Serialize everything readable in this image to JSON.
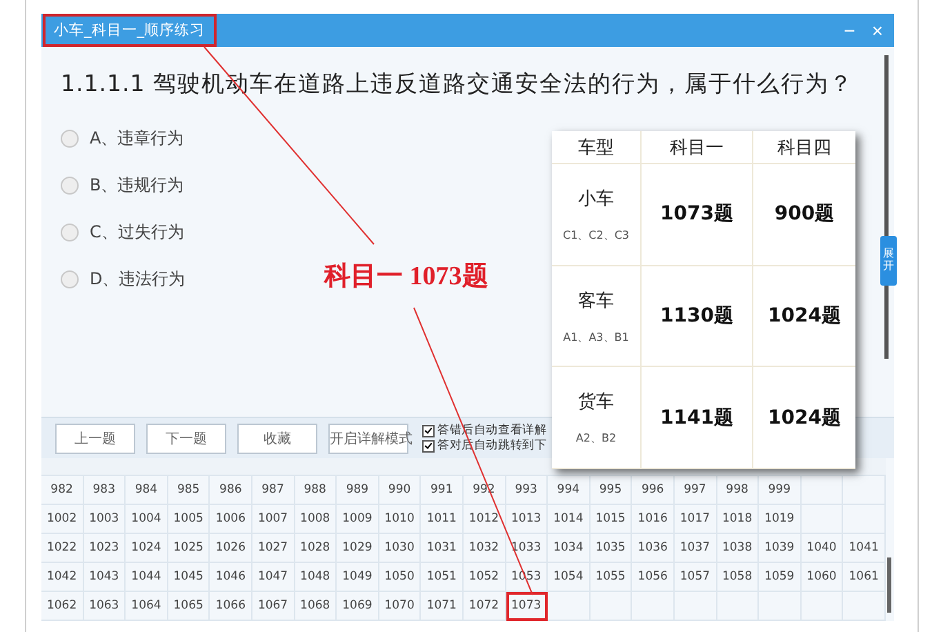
{
  "window": {
    "title": "小车_科目一_顺序练习",
    "controls": [
      "−",
      "×"
    ]
  },
  "question": {
    "text": "1.1.1.1 驾驶机动车在道路上违反道路交通安全法的行为，属于什么行为？",
    "options": [
      {
        "label": "A、违章行为",
        "selected": false
      },
      {
        "label": "B、违规行为",
        "selected": false
      },
      {
        "label": "C、过失行为",
        "selected": false
      },
      {
        "label": "D、违法行为",
        "selected": false
      }
    ]
  },
  "side_tab": "展开",
  "toolbar": {
    "buttons": [
      "上一题",
      "下一题",
      "收藏",
      "开启详解模式"
    ],
    "checkboxes": [
      {
        "label": "答错后自动查看详解",
        "checked": true
      },
      {
        "label": "答对后自动跳转到下",
        "checked": true
      }
    ]
  },
  "grid": {
    "rows": [
      [
        {
          "n": "982",
          "marked": false
        },
        {
          "n": "983",
          "marked": false
        },
        {
          "n": "984",
          "marked": false
        },
        {
          "n": "985",
          "marked": false
        },
        {
          "n": "986",
          "marked": false
        },
        {
          "n": "987",
          "marked": false
        },
        {
          "n": "988",
          "marked": false
        },
        {
          "n": "989",
          "marked": false
        },
        {
          "n": "990",
          "marked": false
        },
        {
          "n": "991",
          "marked": false
        },
        {
          "n": "992",
          "marked": false
        },
        {
          "n": "993",
          "marked": false
        },
        {
          "n": "994",
          "marked": false
        },
        {
          "n": "995",
          "marked": false
        },
        {
          "n": "996",
          "marked": false
        },
        {
          "n": "997",
          "marked": false
        },
        {
          "n": "998",
          "marked": false
        },
        {
          "n": "999",
          "marked": false
        },
        null,
        null
      ],
      [
        {
          "n": "1002",
          "marked": false
        },
        {
          "n": "1003",
          "marked": false
        },
        {
          "n": "1004",
          "marked": false
        },
        {
          "n": "1005",
          "marked": false
        },
        {
          "n": "1006",
          "marked": false
        },
        {
          "n": "1007",
          "marked": false
        },
        {
          "n": "1008",
          "marked": false
        },
        {
          "n": "1009",
          "marked": false
        },
        {
          "n": "1010",
          "marked": false
        },
        {
          "n": "1011",
          "marked": false
        },
        {
          "n": "1012",
          "marked": false
        },
        {
          "n": "1013",
          "marked": false
        },
        {
          "n": "1014",
          "marked": false
        },
        {
          "n": "1015",
          "marked": false
        },
        {
          "n": "1016",
          "marked": false
        },
        {
          "n": "1017",
          "marked": false
        },
        {
          "n": "1018",
          "marked": false
        },
        {
          "n": "1019",
          "marked": false
        },
        null,
        null
      ],
      [
        {
          "n": "1022",
          "marked": false
        },
        {
          "n": "1023",
          "marked": false
        },
        {
          "n": "1024",
          "marked": false
        },
        {
          "n": "1025",
          "marked": false
        },
        {
          "n": "1026",
          "marked": false
        },
        {
          "n": "1027",
          "marked": false
        },
        {
          "n": "1028",
          "marked": false
        },
        {
          "n": "1029",
          "marked": false
        },
        {
          "n": "1030",
          "marked": false
        },
        {
          "n": "1031",
          "marked": false
        },
        {
          "n": "1032",
          "marked": false
        },
        {
          "n": "1033",
          "marked": false
        },
        {
          "n": "1034",
          "marked": false
        },
        {
          "n": "1035",
          "marked": false
        },
        {
          "n": "1036",
          "marked": false
        },
        {
          "n": "1037",
          "marked": false
        },
        {
          "n": "1038",
          "marked": false
        },
        {
          "n": "1039",
          "marked": false
        },
        {
          "n": "1040",
          "marked": false
        },
        {
          "n": "1041",
          "marked": false
        }
      ],
      [
        {
          "n": "1042",
          "marked": false
        },
        {
          "n": "1043",
          "marked": false
        },
        {
          "n": "1044",
          "marked": false
        },
        {
          "n": "1045",
          "marked": false
        },
        {
          "n": "1046",
          "marked": false
        },
        {
          "n": "1047",
          "marked": false
        },
        {
          "n": "1048",
          "marked": false
        },
        {
          "n": "1049",
          "marked": false
        },
        {
          "n": "1050",
          "marked": false
        },
        {
          "n": "1051",
          "marked": false
        },
        {
          "n": "1052",
          "marked": false
        },
        {
          "n": "1053",
          "marked": false
        },
        {
          "n": "1054",
          "marked": false
        },
        {
          "n": "1055",
          "marked": false
        },
        {
          "n": "1056",
          "marked": false
        },
        {
          "n": "1057",
          "marked": false
        },
        {
          "n": "1058",
          "marked": false
        },
        {
          "n": "1059",
          "marked": false
        },
        {
          "n": "1060",
          "marked": false
        },
        {
          "n": "1061",
          "marked": false
        }
      ],
      [
        {
          "n": "1062",
          "marked": false
        },
        {
          "n": "1063",
          "marked": false
        },
        {
          "n": "1064",
          "marked": false
        },
        {
          "n": "1065",
          "marked": false
        },
        {
          "n": "1066",
          "marked": false
        },
        {
          "n": "1067",
          "marked": false
        },
        {
          "n": "1068",
          "marked": false
        },
        {
          "n": "1069",
          "marked": false
        },
        {
          "n": "1070",
          "marked": false
        },
        {
          "n": "1071",
          "marked": false
        },
        {
          "n": "1072",
          "marked": false
        },
        {
          "n": "1073",
          "marked": true
        },
        null,
        null,
        null,
        null,
        null,
        null,
        null,
        null
      ]
    ]
  },
  "overlay_table": {
    "columns": [
      "车型",
      "科目一",
      "科目四"
    ],
    "rows": [
      {
        "type": "小车",
        "licenses": "C1、C2、C3",
        "subject_1": "1073题",
        "subject_4": "900题"
      },
      {
        "type": "客车",
        "licenses": "A1、A3、B1",
        "subject_1": "1130题",
        "subject_4": "1024题"
      },
      {
        "type": "货车",
        "licenses": "A2、B2",
        "subject_1": "1141题",
        "subject_4": "1024题"
      }
    ]
  },
  "annotation": {
    "label": "科目一 1073题"
  }
}
